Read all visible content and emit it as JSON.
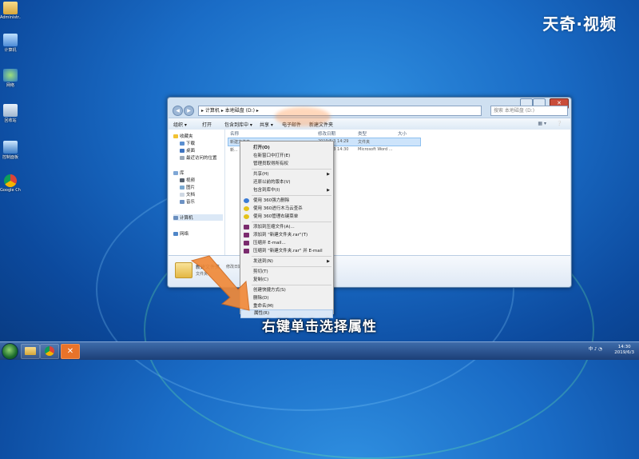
{
  "watermark": "天奇·视频",
  "desktop": {
    "icons": [
      {
        "label": "Administr..."
      },
      {
        "label": "计算机"
      },
      {
        "label": "网络"
      },
      {
        "label": "回收站"
      },
      {
        "label": "控制面板"
      },
      {
        "label": "Google Chrome"
      }
    ]
  },
  "window": {
    "address": "▸ 计算机 ▸ 本地磁盘 (D:) ▸",
    "search_placeholder": "搜索 本地磁盘 (D:)",
    "close_symbol": "✕",
    "toolbar": [
      "组织 ▾",
      "打开",
      "包含到库中 ▾",
      "共享 ▾",
      "电子邮件",
      "新建文件夹"
    ],
    "nav": {
      "favorites": "收藏夹",
      "downloads": "下载",
      "desktop": "桌面",
      "recent": "最近访问的位置",
      "libraries": "库",
      "videos": "视频",
      "pictures": "图片",
      "documents": "文档",
      "music": "音乐",
      "computer": "计算机",
      "network": "网络"
    },
    "columns": {
      "name": "名称",
      "date": "修改日期",
      "type": "类型",
      "size": "大小"
    },
    "files": [
      {
        "name": "新建文件夹",
        "date": "2019/6/3 14:29",
        "type": "文件夹"
      },
      {
        "name": "新...",
        "date": "2019/6/3 14:30",
        "type": "Microsoft Word ..."
      }
    ],
    "details": {
      "name": "新建文件夹",
      "modified_label": "修改日期: 2",
      "type": "文件夹"
    }
  },
  "context_menu": {
    "items": [
      {
        "label": "打开(O)",
        "bold": true
      },
      {
        "label": "在新窗口中打开(E)"
      },
      {
        "label": "管理员取得所有权"
      },
      {
        "label": "共享(H)",
        "submenu": true
      },
      {
        "label": "还原以前的版本(V)"
      },
      {
        "label": "包含到库中(I)",
        "submenu": true
      },
      {
        "label": "使用 360强力删除"
      },
      {
        "label": "使用 360进行木马云查杀"
      },
      {
        "label": "使用 360管理右键菜单"
      },
      {
        "label": "添加到压缩文件(A)..."
      },
      {
        "label": "添加到 \"新建文件夹.rar\"(T)"
      },
      {
        "label": "压缩并 E-mail..."
      },
      {
        "label": "压缩到 \"新建文件夹.rar\" 并 E-mail"
      },
      {
        "label": "发送到(N)",
        "submenu": true
      },
      {
        "label": "剪切(T)"
      },
      {
        "label": "复制(C)"
      },
      {
        "label": "创建快捷方式(S)"
      },
      {
        "label": "删除(D)"
      },
      {
        "label": "重命名(M)"
      },
      {
        "label": "属性(R)"
      }
    ]
  },
  "subtitle": "右键单击选择属性",
  "taskbar": {
    "tray_text": "中 ♪ ◔",
    "time": "14:30",
    "date": "2019/6/3"
  },
  "colors": {
    "highlight": "#d9e7f7",
    "arrow": "#f08a3a"
  }
}
